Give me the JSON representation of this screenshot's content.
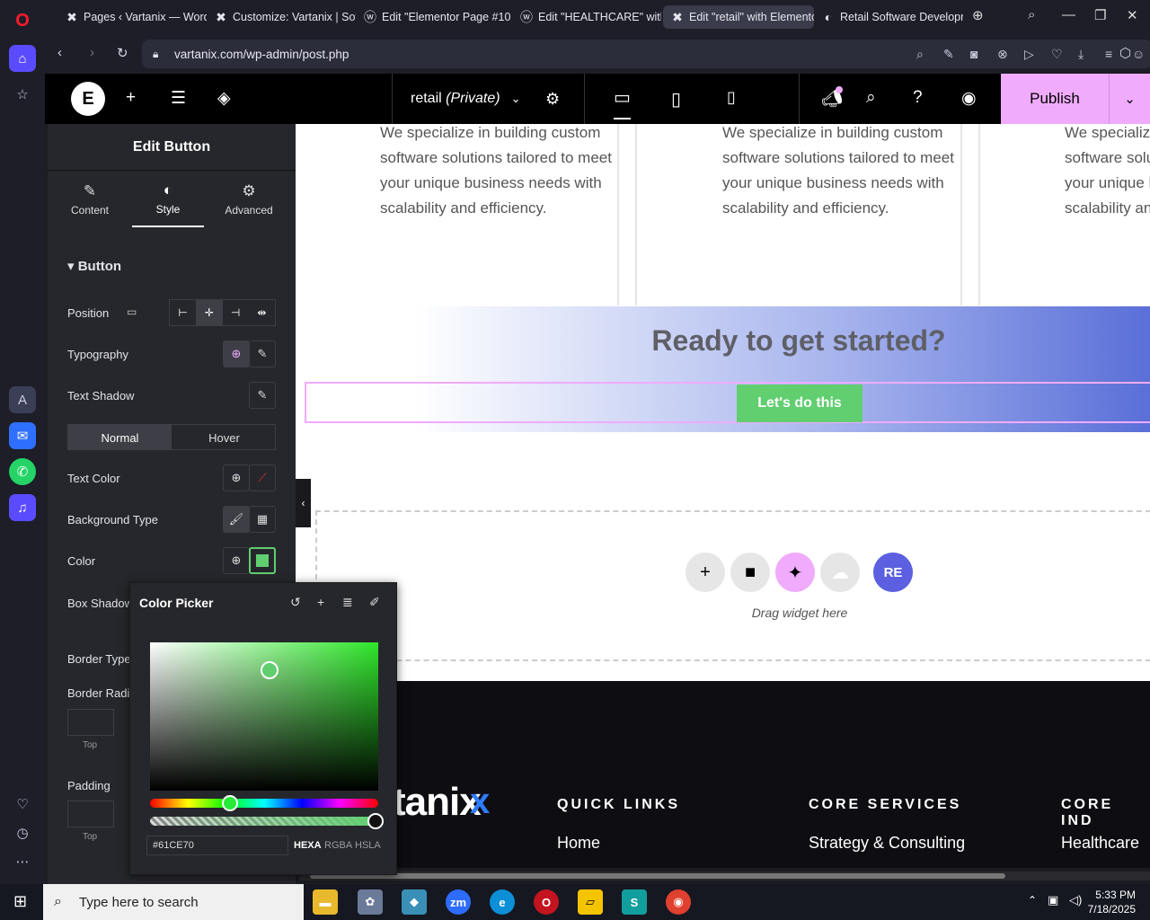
{
  "browser": {
    "tabs": [
      {
        "title": "Pages ‹ Vartanix — WordF",
        "icon": "wordpress-x-icon"
      },
      {
        "title": "Customize: Vartanix | Softw",
        "icon": "wordpress-x-icon"
      },
      {
        "title": "Edit \"Elementor Page #10",
        "icon": "wordpress-icon"
      },
      {
        "title": "Edit \"HEALTHCARE\" with E",
        "icon": "wordpress-icon"
      },
      {
        "title": "Edit \"retail\" with Elemento",
        "icon": "elementor-icon",
        "active": true
      },
      {
        "title": "Retail Software Developm",
        "icon": "site-icon"
      }
    ],
    "url": "vartanix.com/wp-admin/post.php"
  },
  "elementor": {
    "page_name": "retail",
    "page_status": "(Private)",
    "publish_label": "Publish"
  },
  "panel": {
    "title": "Edit Button",
    "tabs": [
      {
        "label": "Content"
      },
      {
        "label": "Style"
      },
      {
        "label": "Advanced"
      }
    ],
    "section": "Button",
    "rows": {
      "position": "Position",
      "typography": "Typography",
      "text_shadow": "Text Shadow",
      "text_color": "Text Color",
      "background_type": "Background Type",
      "color": "Color",
      "box_shadow": "Box Shadow",
      "border_type": "Border Type",
      "border_radius": "Border Radius",
      "padding": "Padding"
    },
    "state_normal": "Normal",
    "state_hover": "Hover",
    "dim_top": "Top"
  },
  "picker": {
    "title": "Color Picker",
    "hex_value": "#61CE70",
    "formats": [
      "HEXA",
      "RGBA",
      "HSLA"
    ]
  },
  "canvas": {
    "service_text": "We specialize in building custom software solutions tailored to meet your unique business needs with scalability and efficiency.",
    "cta_title": "Ready to get started?",
    "cta_button": "Let's do this",
    "drag_hint": "Drag widget here",
    "footer": {
      "logo_text": "tanix",
      "columns": [
        {
          "heading": "QUICK LINKS",
          "first_link": "Home"
        },
        {
          "heading": "CORE SERVICES",
          "first_link": "Strategy & Consulting"
        },
        {
          "heading": "CORE IND",
          "first_link": "Healthcare"
        }
      ]
    }
  },
  "taskbar": {
    "search_placeholder": "Type here to search",
    "time": "5:33 PM",
    "date": "7/18/2025"
  },
  "colors": {
    "accent_pink": "#f0abfc",
    "button_green": "#61CE70"
  }
}
